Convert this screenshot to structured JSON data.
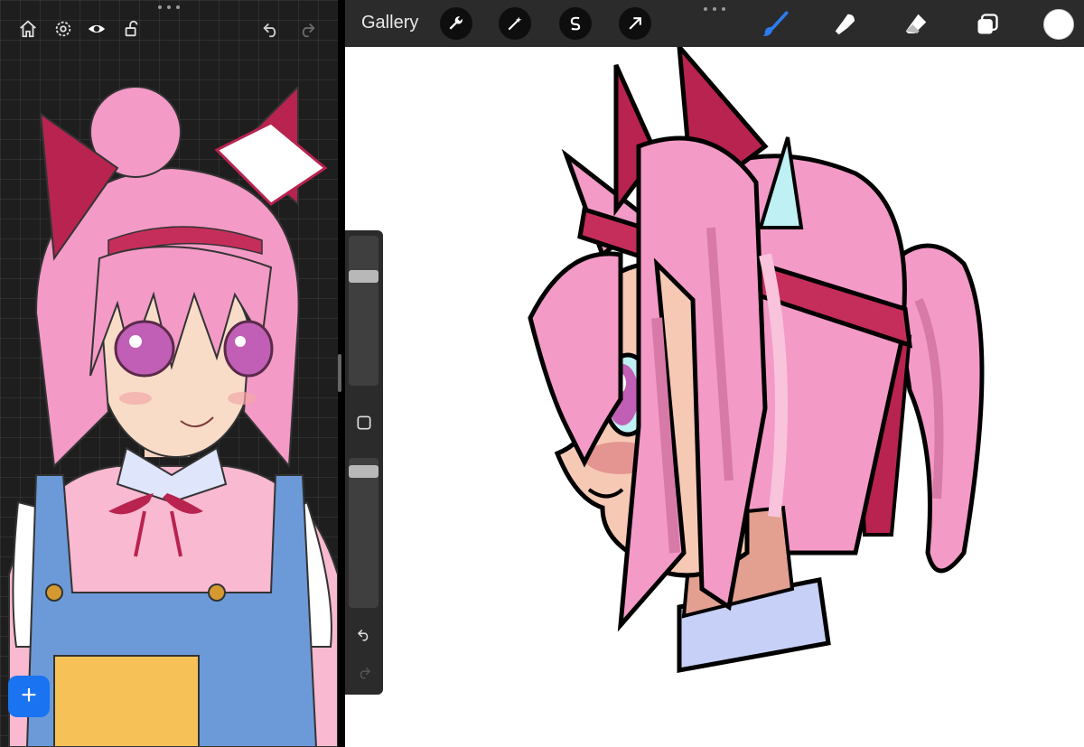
{
  "top_bar": {
    "gallery_label": "Gallery",
    "left_tools": [
      "wrench-icon",
      "magic-wand-icon",
      "selection-icon",
      "transform-arrow-icon"
    ],
    "right_tools": [
      "brush-icon",
      "smudge-icon",
      "eraser-icon",
      "layers-icon"
    ],
    "active_tool": "brush-icon",
    "active_color": "#2e7bf0",
    "current_color": "#ffffff"
  },
  "reference_panel": {
    "tools": [
      "home-icon",
      "settings-icon",
      "eye-icon",
      "unlock-icon",
      "undo-icon",
      "redo-icon"
    ],
    "add_button_label": "+",
    "add_button_color": "#1a73f0"
  },
  "side_panel": {
    "brush_size": 0.25,
    "brush_opacity": 0.05,
    "buttons": [
      "modify-square-icon",
      "undo-icon",
      "redo-icon"
    ]
  },
  "colors": {
    "hair_pink": "#f49ac6",
    "hair_shadow": "#d87aa8",
    "ear_red": "#b8234f",
    "skin": "#f6c9b5",
    "skin_shade": "#e3a090",
    "overalls_blue": "#6c9ad8",
    "shirt_pink": "#f9b9d0",
    "collar": "#c7d0f6",
    "eye_purple": "#c05fb5"
  }
}
